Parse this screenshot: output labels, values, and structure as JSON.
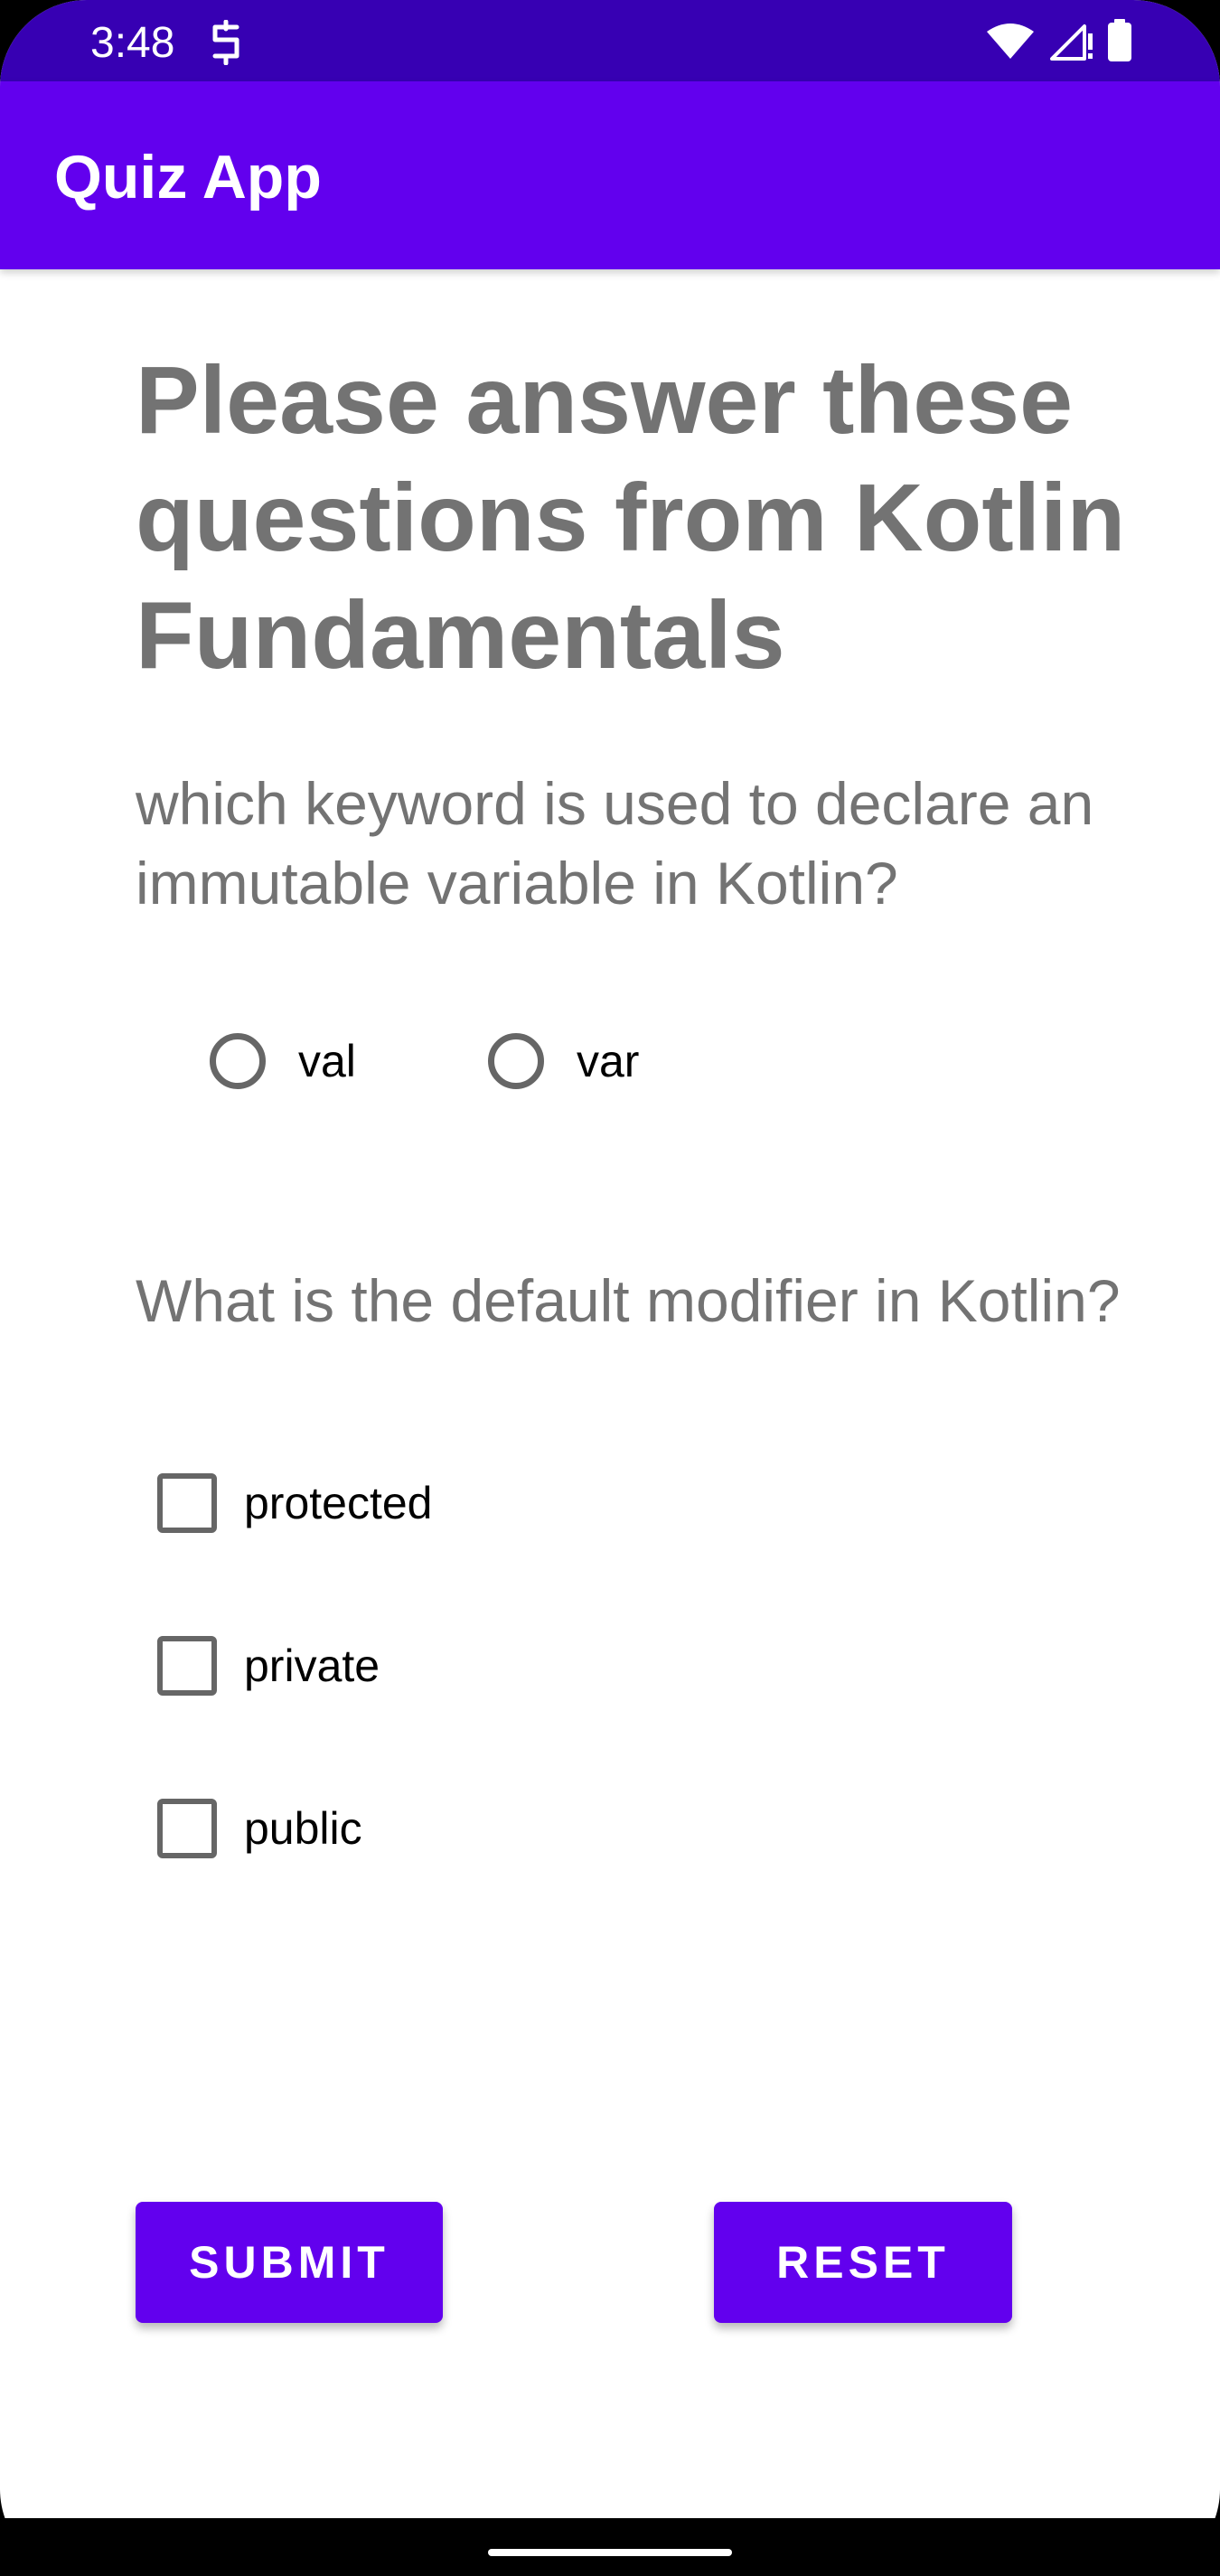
{
  "status_bar": {
    "time": "3:48",
    "background": "#3700b3",
    "icons": [
      "app-notification-icon",
      "wifi-icon",
      "signal-icon",
      "battery-icon"
    ]
  },
  "app_bar": {
    "title": "Quiz App",
    "background": "#6200ee"
  },
  "heading": "Please answer these questions from Kotlin Fundamentals",
  "question1": {
    "text": "which keyword is used to declare an immutable variable in Kotlin?",
    "options": [
      {
        "label": "val",
        "selected": false
      },
      {
        "label": "var",
        "selected": false
      }
    ]
  },
  "question2": {
    "text": "What is the default modifier in Kotlin?",
    "options": [
      {
        "label": "protected",
        "checked": false
      },
      {
        "label": "private",
        "checked": false
      },
      {
        "label": "public",
        "checked": false
      }
    ]
  },
  "buttons": {
    "submit": "SUBMIT",
    "reset": "RESET",
    "color": "#6200ee"
  }
}
